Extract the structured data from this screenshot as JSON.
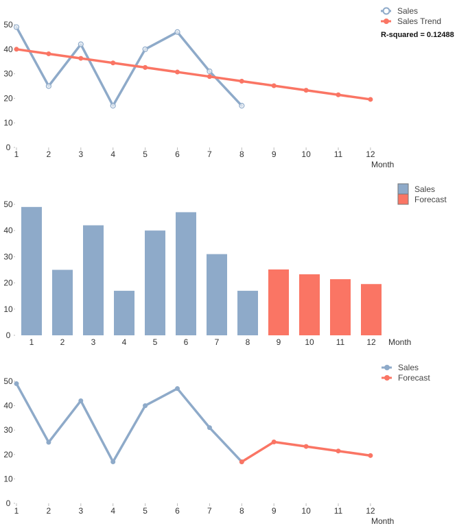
{
  "colors": {
    "sales": "#8eaac9",
    "forecast": "#fa7564",
    "tick": "#bbbbbb",
    "legend_border": "#777777"
  },
  "chart_data": [
    {
      "type": "line",
      "title": "",
      "xlabel": "Month",
      "ylabel": "",
      "x": [
        1,
        2,
        3,
        4,
        5,
        6,
        7,
        8,
        9,
        10,
        11,
        12
      ],
      "ylim": [
        0,
        50
      ],
      "yticks": [
        0,
        10,
        20,
        30,
        40,
        50
      ],
      "grid": false,
      "legend_position": "top-right",
      "series": [
        {
          "name": "Sales",
          "marker": "hollow-circle",
          "color_key": "sales",
          "x": [
            1,
            2,
            3,
            4,
            5,
            6,
            7,
            8
          ],
          "values": [
            49,
            25,
            42,
            17,
            40,
            47,
            31,
            17
          ]
        },
        {
          "name": "Sales Trend",
          "marker": "filled-circle",
          "color_key": "forecast",
          "x": [
            1,
            2,
            3,
            4,
            5,
            6,
            7,
            8,
            9,
            10,
            11,
            12
          ],
          "values": [
            40.0,
            38.14,
            36.29,
            34.43,
            32.57,
            30.71,
            28.86,
            27.0,
            25.14,
            23.29,
            21.43,
            19.57
          ]
        }
      ],
      "annotations": [
        "R-squared = 0.12488"
      ]
    },
    {
      "type": "bar",
      "title": "",
      "xlabel": "Month",
      "ylabel": "",
      "categories": [
        "1",
        "2",
        "3",
        "4",
        "5",
        "6",
        "7",
        "8",
        "9",
        "10",
        "11",
        "12"
      ],
      "ylim": [
        0,
        50
      ],
      "yticks": [
        0,
        10,
        20,
        30,
        40,
        50
      ],
      "grid": false,
      "legend_position": "top-right",
      "series": [
        {
          "name": "Sales",
          "color_key": "sales",
          "values": [
            49,
            25,
            42,
            17,
            40,
            47,
            31,
            17,
            null,
            null,
            null,
            null
          ]
        },
        {
          "name": "Forecast",
          "color_key": "forecast",
          "values": [
            null,
            null,
            null,
            null,
            null,
            null,
            null,
            null,
            25.14,
            23.29,
            21.43,
            19.57
          ]
        }
      ]
    },
    {
      "type": "line",
      "title": "",
      "xlabel": "Month",
      "ylabel": "",
      "x": [
        1,
        2,
        3,
        4,
        5,
        6,
        7,
        8,
        9,
        10,
        11,
        12
      ],
      "ylim": [
        0,
        50
      ],
      "yticks": [
        0,
        10,
        20,
        30,
        40,
        50
      ],
      "grid": false,
      "legend_position": "top-right",
      "series": [
        {
          "name": "Sales",
          "marker": "filled-circle",
          "color_key": "sales",
          "x": [
            1,
            2,
            3,
            4,
            5,
            6,
            7,
            8
          ],
          "values": [
            49,
            25,
            42,
            17,
            40,
            47,
            31,
            17
          ]
        },
        {
          "name": "Forecast",
          "marker": "filled-circle",
          "color_key": "forecast",
          "x": [
            8,
            9,
            10,
            11,
            12
          ],
          "values": [
            17,
            25.14,
            23.29,
            21.43,
            19.57
          ]
        }
      ]
    }
  ]
}
